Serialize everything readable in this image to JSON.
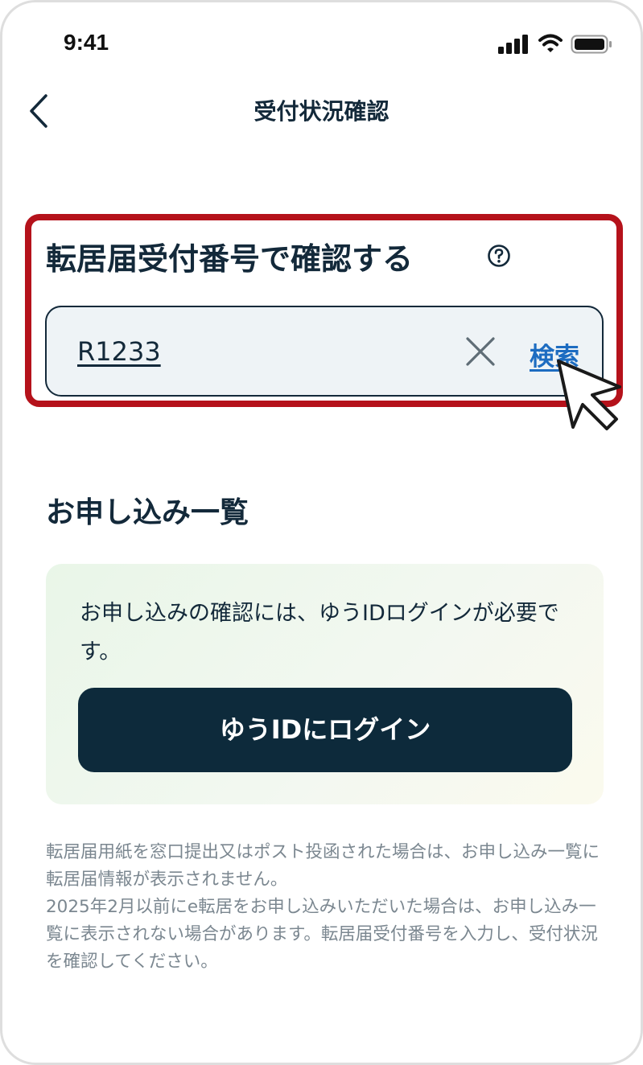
{
  "status_bar": {
    "time": "9:41"
  },
  "nav": {
    "title": "受付状況確認"
  },
  "search_section": {
    "heading": "転居届受付番号で確認する",
    "input_value": "R1233",
    "search_label": "検索"
  },
  "application_list": {
    "heading": "お申し込み一覧",
    "info_text": "お申し込みの確認には、ゆうIDログインが必要です。",
    "login_button_label": "ゆうIDにログイン"
  },
  "notes": {
    "line1": "転居届用紙を窓口提出又はポスト投函された場合は、お申し込み一覧に転居届情報が表示されません。",
    "line2": "2025年2月以前にe転居をお申し込みいただいた場合は、お申し込み一覧に表示されない場合があります。転居届受付番号を入力し、受付状況を確認してください。"
  },
  "colors": {
    "highlight_border": "#b5121b",
    "primary_dark": "#0d2a3b",
    "link_blue": "#1d6cc1"
  },
  "icons": [
    "signal-icon",
    "wifi-icon",
    "battery-icon",
    "back-chevron-icon",
    "help-icon",
    "clear-icon",
    "pointer-cursor-icon"
  ]
}
